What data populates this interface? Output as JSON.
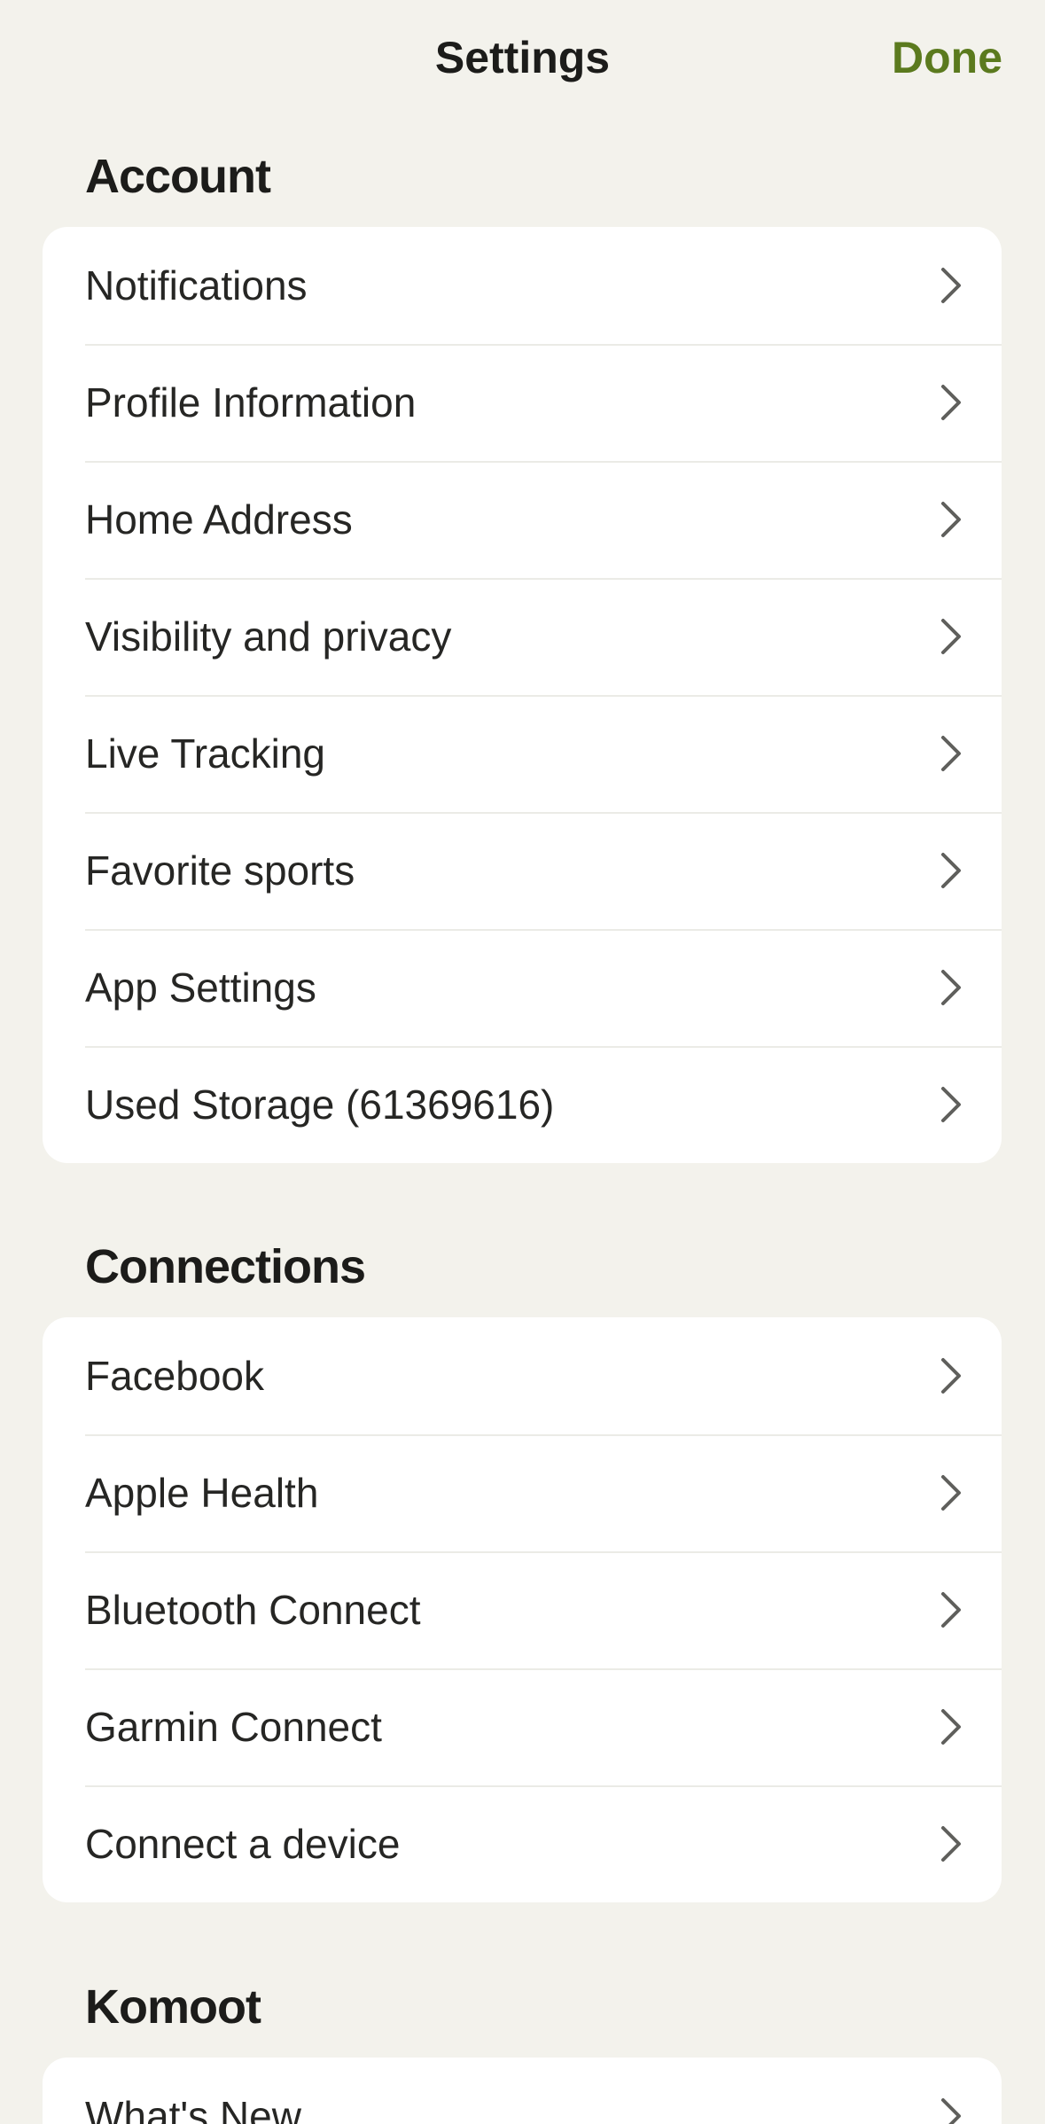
{
  "nav": {
    "title": "Settings",
    "done_label": "Done"
  },
  "colors": {
    "accent": "#5b7a1e",
    "background": "#f3f2ec",
    "card": "#ffffff"
  },
  "sections": [
    {
      "title": "Account",
      "items": [
        {
          "label": "Notifications"
        },
        {
          "label": "Profile Information"
        },
        {
          "label": "Home Address"
        },
        {
          "label": "Visibility and privacy"
        },
        {
          "label": "Live Tracking"
        },
        {
          "label": "Favorite sports"
        },
        {
          "label": "App Settings"
        },
        {
          "label": "Used Storage (61369616)"
        }
      ]
    },
    {
      "title": "Connections",
      "items": [
        {
          "label": "Facebook"
        },
        {
          "label": "Apple Health"
        },
        {
          "label": "Bluetooth Connect"
        },
        {
          "label": "Garmin Connect"
        },
        {
          "label": "Connect a device"
        }
      ]
    },
    {
      "title": "Komoot",
      "items": [
        {
          "label": "What's New"
        }
      ]
    }
  ],
  "icons": {
    "row_trailing": "chevron-right-icon"
  }
}
